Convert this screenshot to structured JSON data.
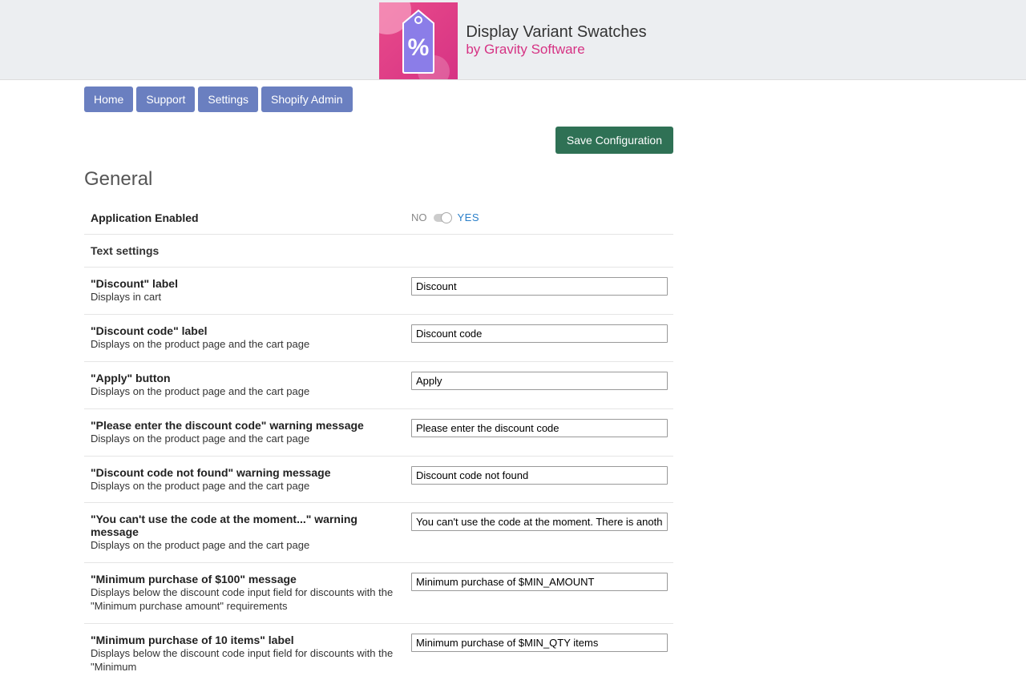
{
  "banner": {
    "title": "Display Variant Swatches",
    "subtitle": "by Gravity Software"
  },
  "nav": {
    "home": "Home",
    "support": "Support",
    "settings": "Settings",
    "shopify_admin": "Shopify Admin"
  },
  "actions": {
    "save": "Save Configuration"
  },
  "section": {
    "title": "General"
  },
  "app_enabled": {
    "label": "Application Enabled",
    "no": "NO",
    "yes": "YES",
    "value": true
  },
  "text_settings_header": "Text settings",
  "fields": [
    {
      "label": "\"Discount\" label",
      "sub": "Displays in cart",
      "value": "Discount"
    },
    {
      "label": "\"Discount code\" label",
      "sub": "Displays on the product page and the cart page",
      "value": "Discount code"
    },
    {
      "label": "\"Apply\" button",
      "sub": "Displays on the product page and the cart page",
      "value": "Apply"
    },
    {
      "label": "\"Please enter the discount code\" warning message",
      "sub": "Displays on the product page and the cart page",
      "value": "Please enter the discount code"
    },
    {
      "label": "\"Discount code not found\" warning message",
      "sub": "Displays on the product page and the cart page",
      "value": "Discount code not found"
    },
    {
      "label": "\"You can't use the code at the moment...\" warning message",
      "sub": "Displays on the product page and the cart page",
      "value": "You can't use the code at the moment. There is another discount applied."
    },
    {
      "label": "\"Minimum purchase of $100\" message",
      "sub": "Displays below the discount code input field for discounts with the \"Minimum purchase amount\" requirements",
      "value": "Minimum purchase of $MIN_AMOUNT"
    },
    {
      "label": "\"Minimum purchase of 10 items\" label",
      "sub": "Displays below the discount code input field for discounts with the \"Minimum",
      "value": "Minimum purchase of $MIN_QTY items"
    }
  ]
}
